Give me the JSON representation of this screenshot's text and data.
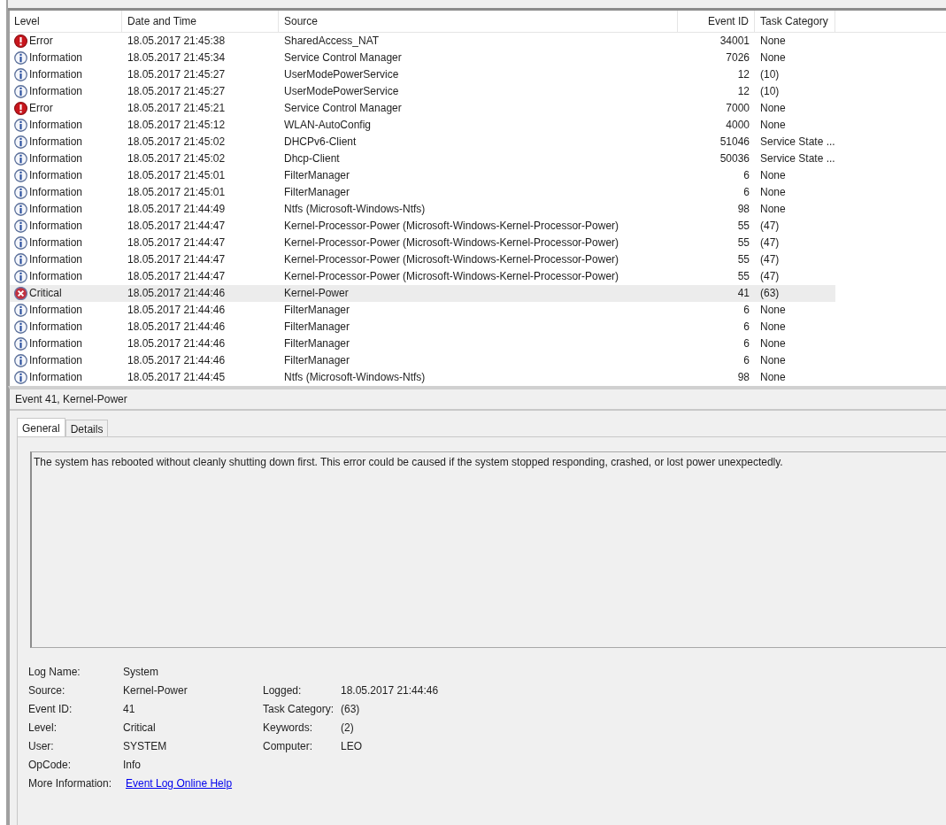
{
  "table": {
    "columns": [
      "Level",
      "Date and Time",
      "Source",
      "Event ID",
      "Task Category"
    ],
    "rows": [
      {
        "kind": "error",
        "level": "Error",
        "date": "18.05.2017 21:45:38",
        "source": "SharedAccess_NAT",
        "event_id": "34001",
        "task": "None",
        "selected": false
      },
      {
        "kind": "information",
        "level": "Information",
        "date": "18.05.2017 21:45:34",
        "source": "Service Control Manager",
        "event_id": "7026",
        "task": "None",
        "selected": false
      },
      {
        "kind": "information",
        "level": "Information",
        "date": "18.05.2017 21:45:27",
        "source": "UserModePowerService",
        "event_id": "12",
        "task": "(10)",
        "selected": false
      },
      {
        "kind": "information",
        "level": "Information",
        "date": "18.05.2017 21:45:27",
        "source": "UserModePowerService",
        "event_id": "12",
        "task": "(10)",
        "selected": false
      },
      {
        "kind": "error",
        "level": "Error",
        "date": "18.05.2017 21:45:21",
        "source": "Service Control Manager",
        "event_id": "7000",
        "task": "None",
        "selected": false
      },
      {
        "kind": "information",
        "level": "Information",
        "date": "18.05.2017 21:45:12",
        "source": "WLAN-AutoConfig",
        "event_id": "4000",
        "task": "None",
        "selected": false
      },
      {
        "kind": "information",
        "level": "Information",
        "date": "18.05.2017 21:45:02",
        "source": "DHCPv6-Client",
        "event_id": "51046",
        "task": "Service State ...",
        "selected": false
      },
      {
        "kind": "information",
        "level": "Information",
        "date": "18.05.2017 21:45:02",
        "source": "Dhcp-Client",
        "event_id": "50036",
        "task": "Service State ...",
        "selected": false
      },
      {
        "kind": "information",
        "level": "Information",
        "date": "18.05.2017 21:45:01",
        "source": "FilterManager",
        "event_id": "6",
        "task": "None",
        "selected": false
      },
      {
        "kind": "information",
        "level": "Information",
        "date": "18.05.2017 21:45:01",
        "source": "FilterManager",
        "event_id": "6",
        "task": "None",
        "selected": false
      },
      {
        "kind": "information",
        "level": "Information",
        "date": "18.05.2017 21:44:49",
        "source": "Ntfs (Microsoft-Windows-Ntfs)",
        "event_id": "98",
        "task": "None",
        "selected": false
      },
      {
        "kind": "information",
        "level": "Information",
        "date": "18.05.2017 21:44:47",
        "source": "Kernel-Processor-Power (Microsoft-Windows-Kernel-Processor-Power)",
        "event_id": "55",
        "task": "(47)",
        "selected": false
      },
      {
        "kind": "information",
        "level": "Information",
        "date": "18.05.2017 21:44:47",
        "source": "Kernel-Processor-Power (Microsoft-Windows-Kernel-Processor-Power)",
        "event_id": "55",
        "task": "(47)",
        "selected": false
      },
      {
        "kind": "information",
        "level": "Information",
        "date": "18.05.2017 21:44:47",
        "source": "Kernel-Processor-Power (Microsoft-Windows-Kernel-Processor-Power)",
        "event_id": "55",
        "task": "(47)",
        "selected": false
      },
      {
        "kind": "information",
        "level": "Information",
        "date": "18.05.2017 21:44:47",
        "source": "Kernel-Processor-Power (Microsoft-Windows-Kernel-Processor-Power)",
        "event_id": "55",
        "task": "(47)",
        "selected": false
      },
      {
        "kind": "critical",
        "level": "Critical",
        "date": "18.05.2017 21:44:46",
        "source": "Kernel-Power",
        "event_id": "41",
        "task": "(63)",
        "selected": true
      },
      {
        "kind": "information",
        "level": "Information",
        "date": "18.05.2017 21:44:46",
        "source": "FilterManager",
        "event_id": "6",
        "task": "None",
        "selected": false
      },
      {
        "kind": "information",
        "level": "Information",
        "date": "18.05.2017 21:44:46",
        "source": "FilterManager",
        "event_id": "6",
        "task": "None",
        "selected": false
      },
      {
        "kind": "information",
        "level": "Information",
        "date": "18.05.2017 21:44:46",
        "source": "FilterManager",
        "event_id": "6",
        "task": "None",
        "selected": false
      },
      {
        "kind": "information",
        "level": "Information",
        "date": "18.05.2017 21:44:46",
        "source": "FilterManager",
        "event_id": "6",
        "task": "None",
        "selected": false
      },
      {
        "kind": "information",
        "level": "Information",
        "date": "18.05.2017 21:44:45",
        "source": "Ntfs (Microsoft-Windows-Ntfs)",
        "event_id": "98",
        "task": "None",
        "selected": false
      }
    ]
  },
  "detail": {
    "title": "Event 41, Kernel-Power",
    "tabs": [
      {
        "label": "General",
        "selected": true
      },
      {
        "label": "Details",
        "selected": false
      }
    ],
    "description": "The system has rebooted without cleanly shutting down first. This error could be caused if the system stopped responding, crashed, or lost power unexpectedly.",
    "properties": [
      {
        "left": {
          "label": "Log Name:",
          "value": "System"
        }
      },
      {
        "left": {
          "label": "Source:",
          "value": "Kernel-Power"
        },
        "right": {
          "label": "Logged:",
          "value": "18.05.2017 21:44:46"
        }
      },
      {
        "left": {
          "label": "Event ID:",
          "value": "41"
        },
        "right": {
          "label": "Task Category:",
          "value": "(63)"
        }
      },
      {
        "left": {
          "label": "Level:",
          "value": "Critical"
        },
        "right": {
          "label": "Keywords:",
          "value": "(2)"
        }
      },
      {
        "left": {
          "label": "User:",
          "value": "SYSTEM"
        },
        "right": {
          "label": "Computer:",
          "value": "LEO"
        }
      },
      {
        "left": {
          "label": "OpCode:",
          "value": "Info"
        }
      },
      {
        "left": {
          "label": "More Information:",
          "link": "Event Log Online Help"
        }
      }
    ]
  }
}
